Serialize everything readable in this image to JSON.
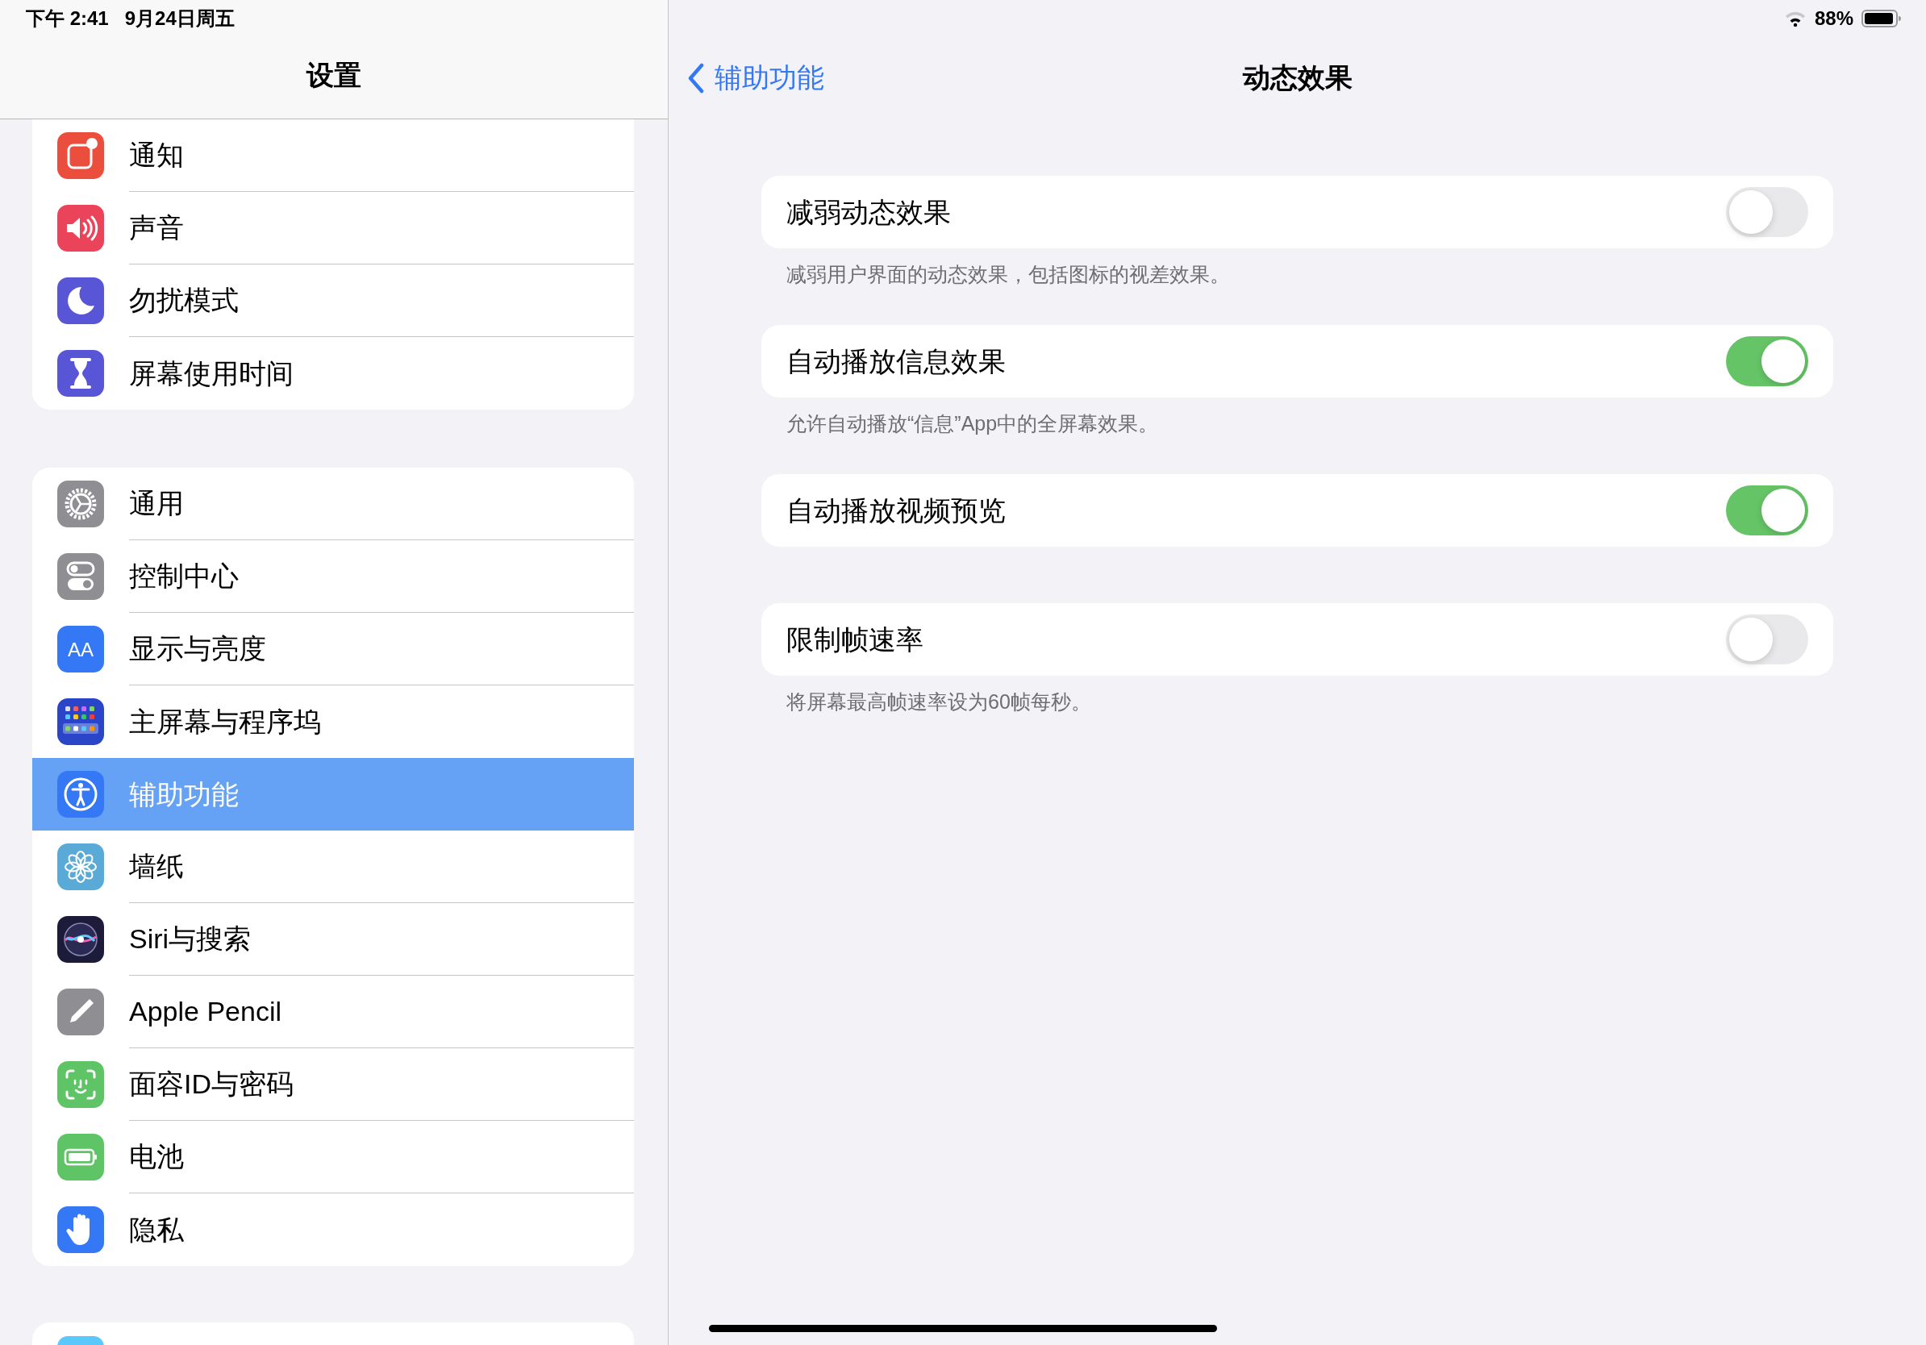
{
  "status_bar": {
    "time": "下午 2:41",
    "date": "9月24日周五",
    "battery": "88%"
  },
  "sidebar": {
    "title": "设置",
    "groups": [
      [
        {
          "label": "通知",
          "kind": "notification",
          "color": "#eb4e3d",
          "selected": false
        },
        {
          "label": "声音",
          "kind": "speaker",
          "color": "#eb445a",
          "selected": false
        },
        {
          "label": "勿扰模式",
          "kind": "moon",
          "color": "#5856d6",
          "selected": false
        },
        {
          "label": "屏幕使用时间",
          "kind": "hourglass",
          "color": "#5856d6",
          "selected": false
        }
      ],
      [
        {
          "label": "通用",
          "kind": "gear",
          "color": "#8e8e93",
          "selected": false
        },
        {
          "label": "控制中心",
          "kind": "toggles",
          "color": "#8e8e93",
          "selected": false
        },
        {
          "label": "显示与亮度",
          "kind": "text-size",
          "glyph": "AA",
          "color": "#3478f6",
          "selected": false
        },
        {
          "label": "主屏幕与程序坞",
          "kind": "grid",
          "color": "#2b45c9",
          "selected": false
        },
        {
          "label": "辅助功能",
          "kind": "accessibility",
          "color": "#3478f6",
          "selected": true
        },
        {
          "label": "墙纸",
          "kind": "flower",
          "color": "#5aaad8",
          "selected": false
        },
        {
          "label": "Siri与搜索",
          "kind": "siri",
          "color": "#1c1c3a",
          "selected": false
        },
        {
          "label": "Apple Pencil",
          "kind": "pencil",
          "color": "#8e8e93",
          "selected": false
        },
        {
          "label": "面容ID与密码",
          "kind": "face",
          "color": "#5fc466",
          "selected": false
        },
        {
          "label": "电池",
          "kind": "battery",
          "color": "#5fc466",
          "selected": false
        },
        {
          "label": "隐私",
          "kind": "hand",
          "color": "#3478f6",
          "selected": false
        }
      ]
    ]
  },
  "detail": {
    "back": "辅助功能",
    "title": "动态效果",
    "settings": [
      {
        "label": "减弱动态效果",
        "on": false,
        "footer": "减弱用户界面的动态效果，包括图标的视差效果。"
      },
      {
        "label": "自动播放信息效果",
        "on": true,
        "footer": "允许自动播放“信息”App中的全屏幕效果。"
      },
      {
        "label": "自动播放视频预览",
        "on": true
      },
      {
        "label": "限制帧速率",
        "on": false,
        "footer": "将屏幕最高帧速率设为60帧每秒。"
      }
    ]
  }
}
